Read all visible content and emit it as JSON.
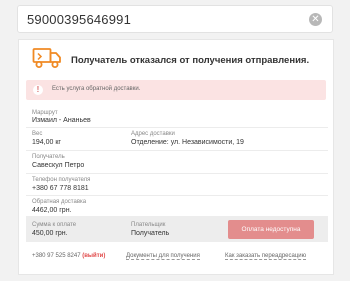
{
  "search": {
    "value": "59000395646991"
  },
  "status": {
    "headline": "Получатель отказался от получения отправления."
  },
  "alert": {
    "text": "Есть услуга обратной доставки."
  },
  "route": {
    "label": "Маршрут",
    "value": "Измаил - Ананьев"
  },
  "weight": {
    "label": "Вес",
    "value": "194,00 кг"
  },
  "address": {
    "label": "Адрес доставки",
    "value": "Отделение: ул. Независимости, 19"
  },
  "recipient": {
    "label": "Получатель",
    "value": "Савескул Петро"
  },
  "phone": {
    "label": "Телефон получателя",
    "value": "+380 67 778 8181"
  },
  "return_delivery": {
    "label": "Обратная доставка",
    "value": "4462,00 грн."
  },
  "payment": {
    "sum_label": "Сумма к оплате",
    "sum_value": "450,00 грн.",
    "payer_label": "Плательщик",
    "payer_value": "Получатель",
    "button": "Оплата недоступна"
  },
  "footer": {
    "phone": "+380 97 525 8247",
    "exit": "(выйти)",
    "docs_link": "Документы для получения",
    "redirect_link": "Как заказать переадресацию"
  },
  "colors": {
    "alert_bg": "#fbe3e3",
    "accent": "#f08a24",
    "button": "#e38d8d",
    "exit": "#e04848"
  },
  "icons": {
    "truck": "truck-icon",
    "clear": "clear-icon",
    "alert": "exclamation-icon"
  }
}
